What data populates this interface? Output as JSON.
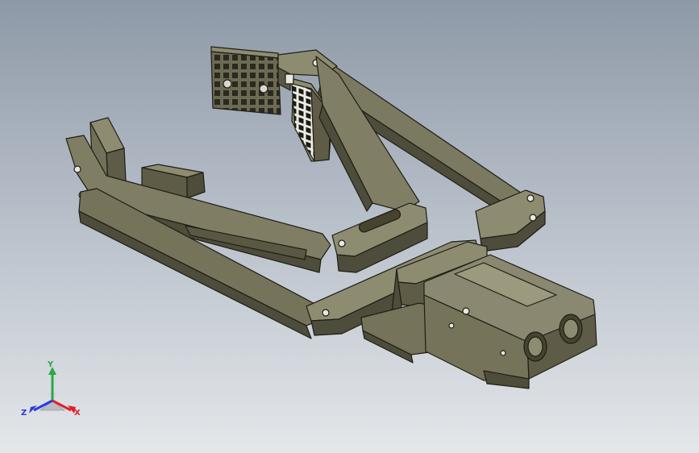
{
  "viewport": {
    "background_top": "#8e99a7",
    "background_bottom": "#e4e7ea"
  },
  "model": {
    "fill": "#737157",
    "fill_light": "#8e8c70",
    "fill_dark": "#4e4c3a",
    "edge": "#1e1e16"
  },
  "triad": {
    "x_label": "X",
    "y_label": "Y",
    "z_label": "Z",
    "x_color": "#e0202a",
    "y_color": "#2aa84a",
    "z_color": "#2a3ad8"
  }
}
